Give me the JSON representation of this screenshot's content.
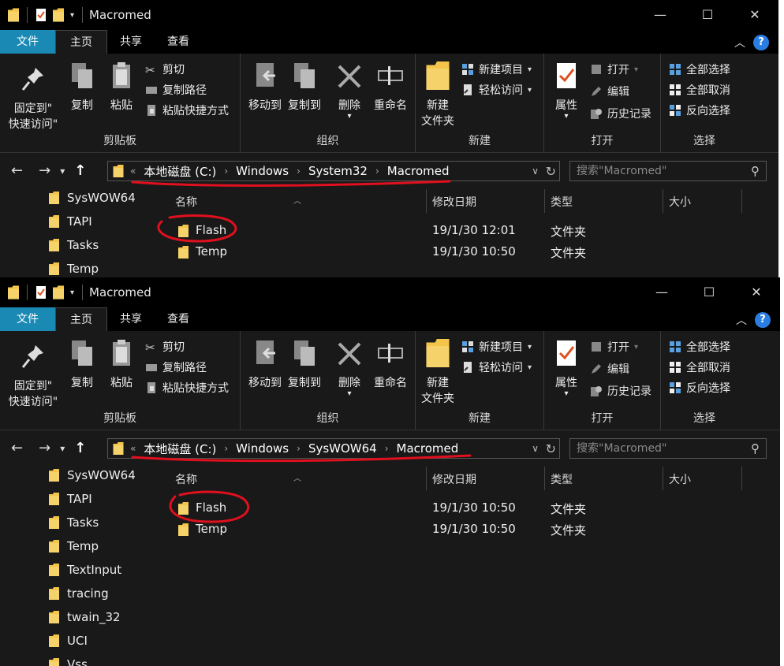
{
  "windows": [
    {
      "title": "Macromed",
      "tabs": [
        "文件",
        "主页",
        "共享",
        "查看"
      ],
      "ribbon": {
        "clipboard": {
          "label": "剪贴板",
          "pin": "固定到\"\n快速访问\"",
          "pin1": "固定到\"",
          "pin2": "快速访问\"",
          "copy": "复制",
          "paste": "粘贴",
          "cut": "剪切",
          "copy_path": "复制路径",
          "paste_shortcut": "粘贴快捷方式"
        },
        "organize": {
          "label": "组织",
          "move_to": "移动到",
          "copy_to": "复制到",
          "delete": "删除",
          "rename": "重命名"
        },
        "new": {
          "label": "新建",
          "new_folder_1": "新建",
          "new_folder_2": "文件夹",
          "new_item": "新建项目",
          "easy_access": "轻松访问"
        },
        "open": {
          "label": "打开",
          "properties": "属性",
          "open": "打开",
          "edit": "编辑",
          "history": "历史记录"
        },
        "select": {
          "label": "选择",
          "select_all": "全部选择",
          "select_none": "全部取消",
          "invert": "反向选择"
        }
      },
      "address": {
        "prefix": "«",
        "crumbs": [
          "本地磁盘 (C:)",
          "Windows",
          "System32",
          "Macromed"
        ]
      },
      "search_placeholder": "搜索\"Macromed\"",
      "nav_items": [
        "SysWOW64",
        "TAPI",
        "Tasks",
        "Temp"
      ],
      "columns": [
        "名称",
        "修改日期",
        "类型",
        "大小"
      ],
      "files": [
        {
          "name": "Flash",
          "date": "19/1/30 12:01",
          "type": "文件夹"
        },
        {
          "name": "Temp",
          "date": "19/1/30 10:50",
          "type": "文件夹"
        }
      ]
    },
    {
      "title": "Macromed",
      "tabs": [
        "文件",
        "主页",
        "共享",
        "查看"
      ],
      "ribbon": {
        "clipboard": {
          "label": "剪贴板",
          "pin1": "固定到\"",
          "pin2": "快速访问\"",
          "copy": "复制",
          "paste": "粘贴",
          "cut": "剪切",
          "copy_path": "复制路径",
          "paste_shortcut": "粘贴快捷方式"
        },
        "organize": {
          "label": "组织",
          "move_to": "移动到",
          "copy_to": "复制到",
          "delete": "删除",
          "rename": "重命名"
        },
        "new": {
          "label": "新建",
          "new_folder_1": "新建",
          "new_folder_2": "文件夹",
          "new_item": "新建项目",
          "easy_access": "轻松访问"
        },
        "open": {
          "label": "打开",
          "properties": "属性",
          "open": "打开",
          "edit": "编辑",
          "history": "历史记录"
        },
        "select": {
          "label": "选择",
          "select_all": "全部选择",
          "select_none": "全部取消",
          "invert": "反向选择"
        }
      },
      "address": {
        "prefix": "«",
        "crumbs": [
          "本地磁盘 (C:)",
          "Windows",
          "SysWOW64",
          "Macromed"
        ]
      },
      "search_placeholder": "搜索\"Macromed\"",
      "nav_items": [
        "SysWOW64",
        "TAPI",
        "Tasks",
        "Temp",
        "TextInput",
        "tracing",
        "twain_32",
        "UCI",
        "Vss"
      ],
      "columns": [
        "名称",
        "修改日期",
        "类型",
        "大小"
      ],
      "files": [
        {
          "name": "Flash",
          "date": "19/1/30 10:50",
          "type": "文件夹"
        },
        {
          "name": "Temp",
          "date": "19/1/30 10:50",
          "type": "文件夹"
        }
      ]
    }
  ],
  "colors": {
    "bg": "#191919",
    "titlebar": "#000000",
    "file_tab": "#1a8ab5",
    "folder": "#f0c040",
    "annotation": "#e0101e",
    "help": "#2a7de1"
  }
}
